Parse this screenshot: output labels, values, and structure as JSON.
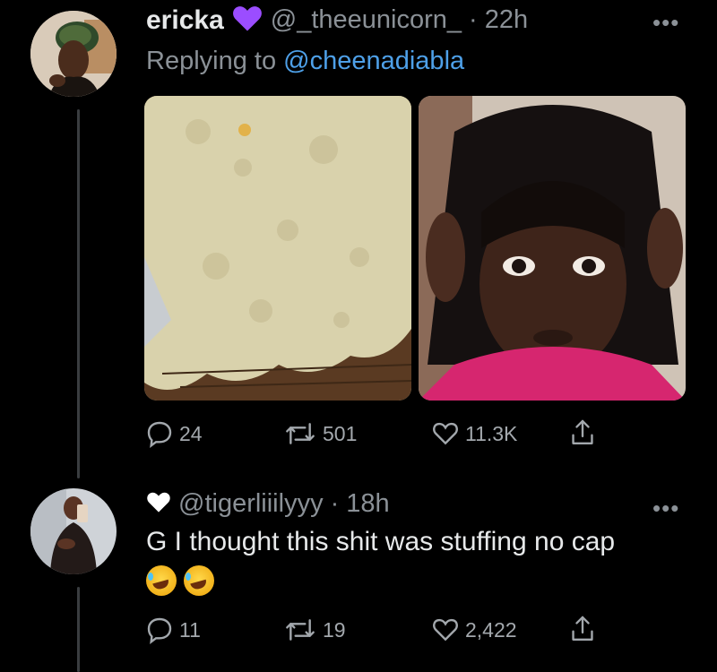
{
  "tweet": {
    "display_name": "ericka",
    "verified_icon": "purple-heart-icon",
    "handle": "@_theeunicorn_",
    "separator": "·",
    "time": "22h",
    "replying_prefix": "Replying to",
    "replying_to": "@cheenadiabla",
    "more": "•••",
    "media": [
      {
        "description_icon": "photo-thumbnail",
        "accent": "#d8d0a8"
      },
      {
        "description_icon": "photo-thumbnail",
        "accent": "#6b4a3c"
      }
    ],
    "actions": {
      "replies": "24",
      "retweets": "501",
      "likes": "11.3K"
    }
  },
  "reply": {
    "heart_icon": "heart-icon",
    "handle": "@tigerliiilyyy",
    "separator": "·",
    "time": "18h",
    "more": "•••",
    "text": "G I thought this shit was stuffing no cap",
    "emojis": [
      "rolling-on-floor-laughing",
      "rolling-on-floor-laughing"
    ],
    "actions": {
      "replies": "11",
      "retweets": "19",
      "likes": "2,422"
    }
  },
  "colors": {
    "background": "#000000",
    "text": "#e7e9ea",
    "muted": "#8b9197",
    "link": "#4ea0e8",
    "verified_heart": "#9b4dff"
  }
}
